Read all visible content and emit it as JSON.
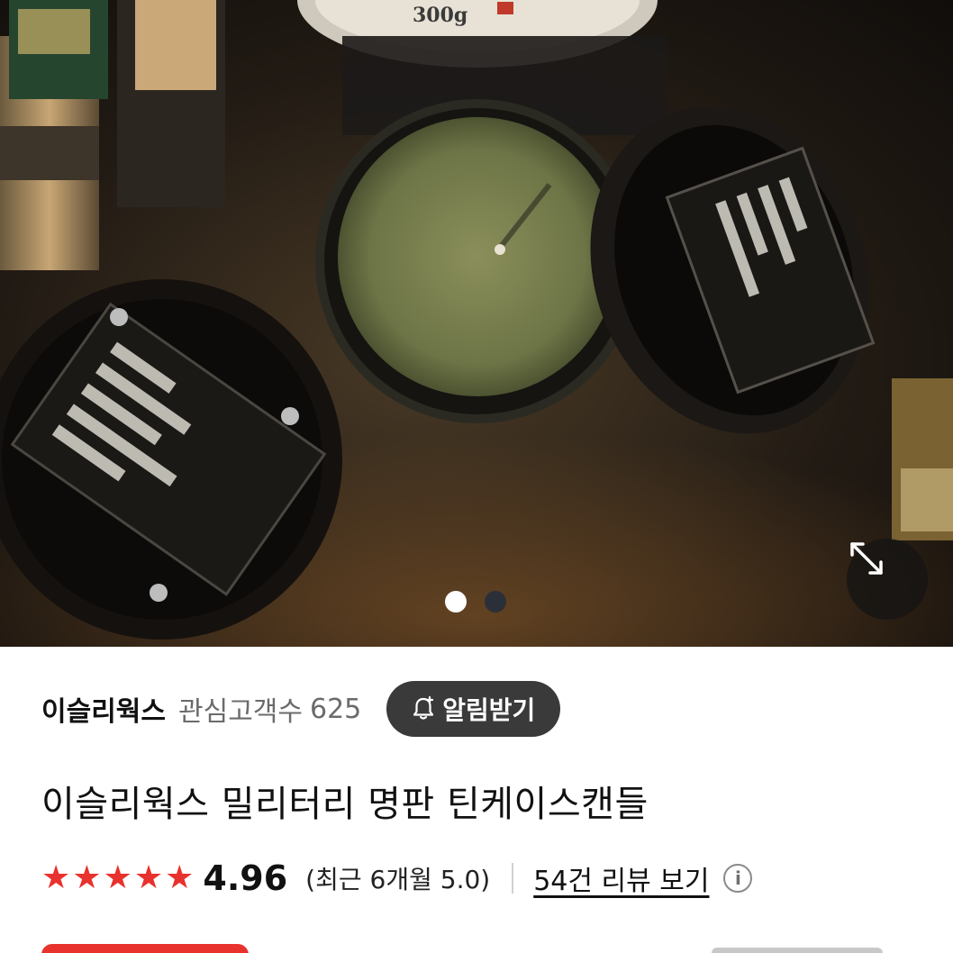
{
  "gallery": {
    "pagination": {
      "total": 2,
      "active_index": 0
    },
    "expand_icon": "expand-arrows-icon"
  },
  "store": {
    "name": "이슬리웍스",
    "follower_label": "관심고객수",
    "follower_count": "625",
    "alarm_button_label": "알림받기",
    "alarm_icon": "bell-plus-icon"
  },
  "product": {
    "title": "이슬리웍스 밀리터리 명판 틴케이스캔들"
  },
  "rating": {
    "stars": 5,
    "score": "4.96",
    "recent": "(최근 6개월 5.0)",
    "review_link": "54건 리뷰 보기",
    "info_icon": "info-icon"
  },
  "colors": {
    "accent": "#e8322d",
    "button_dark": "#3a3a3a",
    "muted_text": "#6b6b6b"
  }
}
